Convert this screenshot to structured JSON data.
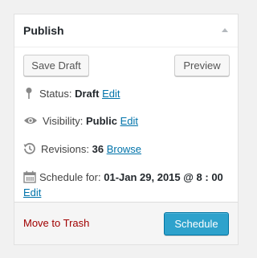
{
  "panel": {
    "title": "Publish",
    "toggle_icon": "triangle-up-icon"
  },
  "actions": {
    "save_draft_label": "Save Draft",
    "preview_label": "Preview"
  },
  "status": {
    "icon": "pin-icon",
    "label": "Status:",
    "value": "Draft",
    "edit_label": "Edit"
  },
  "visibility": {
    "icon": "eye-icon",
    "label": "Visibility:",
    "value": "Public",
    "edit_label": "Edit"
  },
  "revisions": {
    "icon": "history-icon",
    "label": "Revisions:",
    "count": "36",
    "browse_label": "Browse"
  },
  "schedule": {
    "icon": "calendar-icon",
    "label": "Schedule for:",
    "value": "01-Jan 29, 2015 @ 8 : 00",
    "edit_label": "Edit"
  },
  "footer": {
    "trash_label": "Move to Trash",
    "schedule_label": "Schedule"
  },
  "colors": {
    "link": "#0073aa",
    "trash": "#a00000",
    "primary_button": "#2ea2cc"
  }
}
